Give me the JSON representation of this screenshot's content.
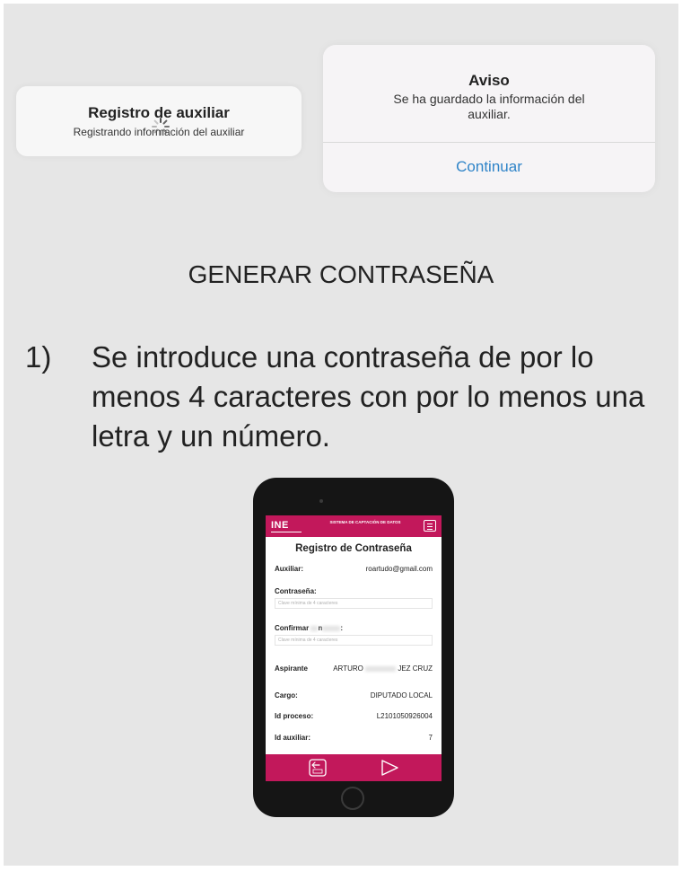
{
  "dialogs": {
    "registro": {
      "title": "Registro de auxiliar",
      "subtitle": "Registrando información del auxiliar"
    },
    "aviso": {
      "title": "Aviso",
      "message": "Se ha guardado  la información del auxiliar.",
      "button": "Continuar"
    }
  },
  "section": {
    "title": "GENERAR CONTRASEÑA"
  },
  "step": {
    "number": "1)",
    "text": "Se introduce una contraseña de por lo menos 4 caracteres con por lo menos una letra y un número."
  },
  "phone": {
    "app": {
      "logo": "INE",
      "system_name": "SISTEMA DE CAPTACIÓN DE DATOS",
      "form_title": "Registro de Contraseña",
      "auxiliar_label": "Auxiliar:",
      "auxiliar_value": "roartudo@gmail.com",
      "password_label": "Contraseña:",
      "password_placeholder": "Clave mínima de 4 caracteres",
      "confirm_label_start": "Confirmar",
      "confirm_label_mid": "n",
      "confirm_label_end": ":",
      "confirm_placeholder": "Clave mínima de 4 caracteres",
      "aspirante_label": "Aspirante",
      "aspirante_first": "ARTURO",
      "aspirante_last": "JEZ CRUZ",
      "cargo_label": "Cargo:",
      "cargo_value": "DIPUTADO LOCAL",
      "proceso_label": "Id proceso:",
      "proceso_value": "L2101050926004",
      "auxiliar_id_label": "Id auxiliar:",
      "auxiliar_id_value": "7",
      "back_icon": "back-icon",
      "send_icon": "send-icon"
    }
  },
  "colors": {
    "accent": "#c2185b",
    "link": "#2f84c8",
    "background": "#e6e6e6"
  }
}
